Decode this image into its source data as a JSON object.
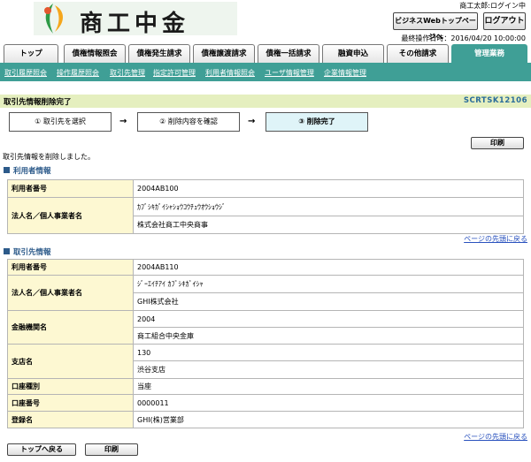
{
  "header": {
    "logo_text": "商工中金",
    "user_status": "商工太郎:ログイン中",
    "biz_button": "ビジネスWebトップページへ",
    "logout_button": "ログアウト",
    "last_operation": "最終操作日時：2016/04/20 10:00:00"
  },
  "tabs": [
    "トップ",
    "債権情報照会",
    "債権発生請求",
    "債権譲渡請求",
    "債権一括請求",
    "融資申込",
    "その他請求",
    "管理業務"
  ],
  "active_tab": "管理業務",
  "subnav": [
    "取引履歴照会",
    "操作履歴照会",
    "取引先管理",
    "指定許可管理",
    "利用者情報照会",
    "ユーザ情報管理",
    "企業情報管理"
  ],
  "page": {
    "title": "取引先情報削除完了",
    "screen_code": "SCRTSK12106",
    "message": "取引先情報を削除しました。",
    "print_label": "印刷"
  },
  "steps": [
    {
      "label": "① 取引先を選択",
      "state": "normal"
    },
    {
      "label": "② 削除内容を確認",
      "state": "normal"
    },
    {
      "label": "③ 削除完了",
      "state": "current"
    }
  ],
  "step_arrow": "→",
  "user_section": {
    "title": "利用者情報",
    "rows": [
      {
        "label": "利用者番号",
        "values": [
          "2004AB100"
        ]
      },
      {
        "label": "法人名／個人事業者名",
        "values": [
          "ｶﾌﾞｼｷｶﾞｲｼｬｼｮｳｺｳﾁｭｳｵｳｼｮｳｼﾞ",
          "株式会社商工中央商事"
        ]
      }
    ]
  },
  "partner_section": {
    "title": "取引先情報",
    "rows": [
      {
        "label": "利用者番号",
        "values": [
          "2004AB110"
        ]
      },
      {
        "label": "法人名／個人事業者名",
        "values": [
          "ｼﾞｰｴｲﾁｱｲ ｶﾌﾞｼｷｶﾞｲｼｬ",
          "GHI株式会社"
        ]
      },
      {
        "label": "金融機関名",
        "values": [
          "2004",
          "商工組合中央金庫"
        ]
      },
      {
        "label": "支店名",
        "values": [
          "130",
          "渋谷支店"
        ]
      },
      {
        "label": "口座種別",
        "values": [
          "当座"
        ]
      },
      {
        "label": "口座番号",
        "values": [
          "0000011"
        ]
      },
      {
        "label": "登録名",
        "values": [
          "GHI(株)営業部"
        ]
      }
    ]
  },
  "page_top_link": "ページの先頭に戻る",
  "bottom": {
    "back_to_top": "トップへ戻る",
    "print": "印刷"
  },
  "colors": {
    "accent": "#3f9f96",
    "title_bar": "#e5efbf",
    "label_cell": "#fdf8d2",
    "section_title": "#2c5a8a",
    "link": "#2a52be"
  }
}
